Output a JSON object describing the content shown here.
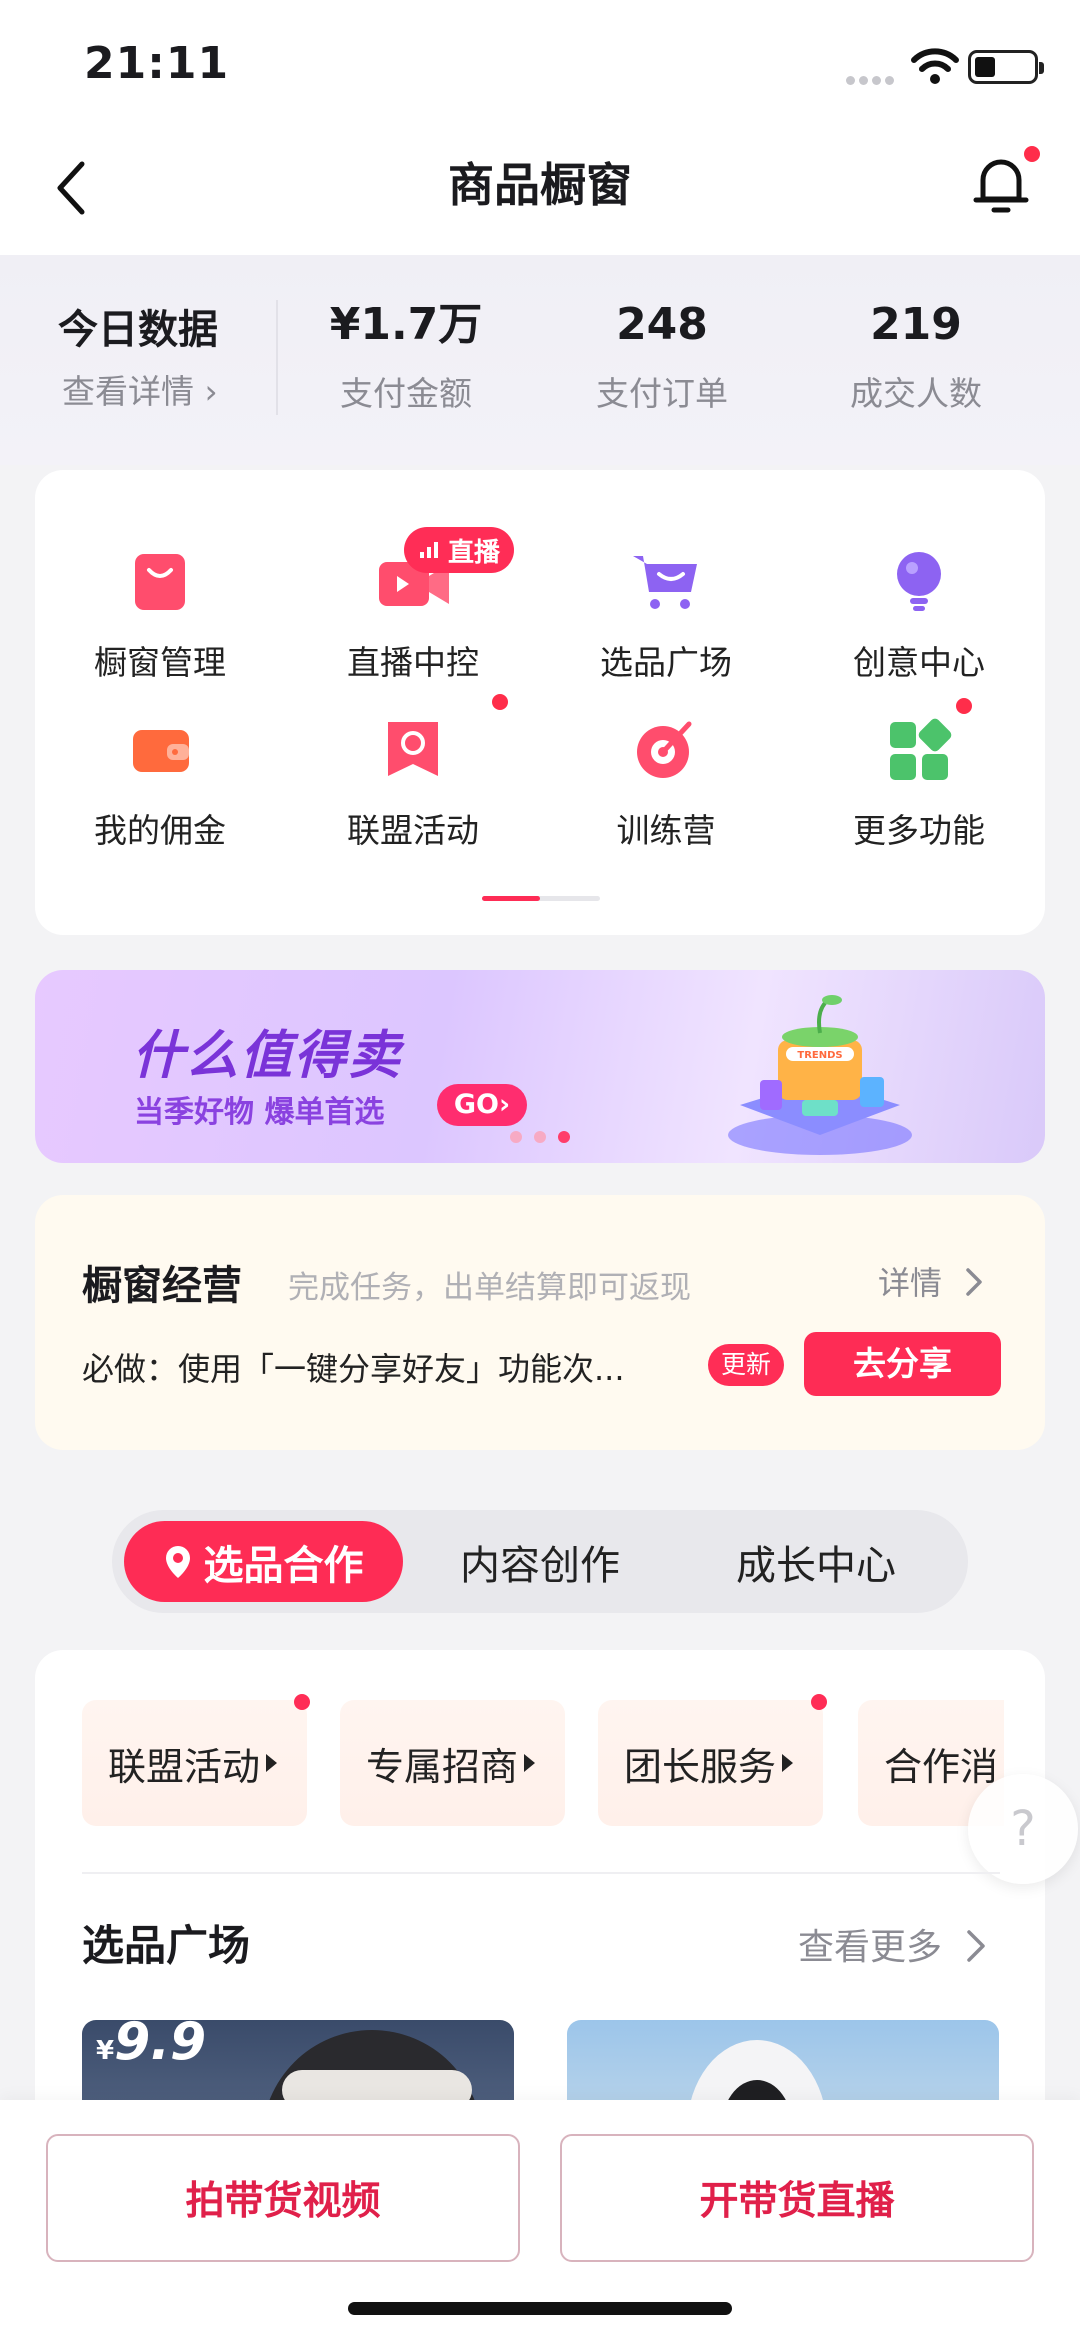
{
  "status_bar": {
    "time": "21:11"
  },
  "nav": {
    "title": "商品橱窗"
  },
  "today": {
    "title": "今日数据",
    "link": "查看详情 ›",
    "stats": [
      {
        "value": "¥1.7万",
        "label": "支付金额"
      },
      {
        "value": "248",
        "label": "支付订单"
      },
      {
        "value": "219",
        "label": "成交人数"
      }
    ]
  },
  "functions": {
    "live_badge": "直播",
    "items": [
      {
        "label": "橱窗管理",
        "icon": "shopping-bag-icon"
      },
      {
        "label": "直播中控",
        "icon": "live-camera-icon"
      },
      {
        "label": "选品广场",
        "icon": "cart-icon"
      },
      {
        "label": "创意中心",
        "icon": "lightbulb-icon"
      },
      {
        "label": "我的佣金",
        "icon": "wallet-icon"
      },
      {
        "label": "联盟活动",
        "icon": "flower-badge-icon"
      },
      {
        "label": "训练营",
        "icon": "target-icon"
      },
      {
        "label": "更多功能",
        "icon": "grid-icon"
      }
    ]
  },
  "banner": {
    "title": "什么值得卖",
    "subtitle": "当季好物 爆单首选",
    "go": "GO›",
    "art_label": "TRENDS"
  },
  "operations": {
    "title": "橱窗经营",
    "subtitle": "完成任务，出单结算即可返现",
    "detail": "详情",
    "task": "必做：使用「一键分享好友」功能次...",
    "new_badge": "更新",
    "share_button": "去分享"
  },
  "segments": {
    "active": "选品合作",
    "tab2": "内容创作",
    "tab3": "成长中心"
  },
  "chips": [
    "联盟活动",
    "专属招商",
    "团长服务",
    "合作消"
  ],
  "plaza": {
    "title": "选品广场",
    "more": "查看更多",
    "price_currency": "¥",
    "price_value": "9.9"
  },
  "help": {
    "symbol": "?"
  },
  "bottom": {
    "video_button": "拍带货视频",
    "live_button": "开带货直播"
  },
  "colors": {
    "accent": "#fe2c55",
    "banner_purple": "#7a33d8"
  }
}
